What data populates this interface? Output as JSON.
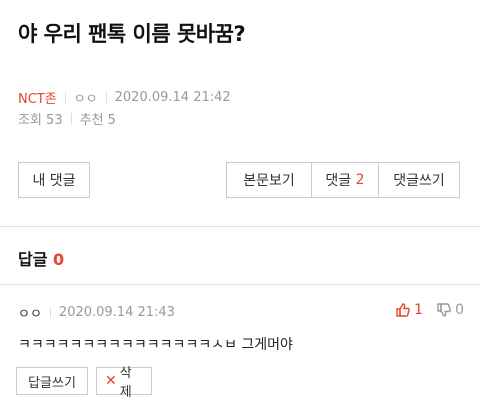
{
  "post": {
    "title": "야 우리 팬톡 이름 못바꿈?",
    "board": "NCT존",
    "author": "ㅇㅇ",
    "datetime": "2020.09.14 21:42",
    "views": "조회 53",
    "recommend": "추천 5"
  },
  "buttons": {
    "my_comments": "내 댓글",
    "view_body": "본문보기",
    "comments_label": "댓글",
    "comments_count": "2",
    "write_comment": "댓글쓰기"
  },
  "replies": {
    "label": "답글",
    "count": "0"
  },
  "comment": {
    "author": "ㅇㅇ",
    "datetime": "2020.09.14 21:43",
    "likes": "1",
    "dislikes": "0",
    "text": "ㅋㅋㅋㅋㅋㅋㅋㅋㅋㅋㅋㅋㅋㅋㅋㅅㅂ 그게머야",
    "reply_button": "답글쓰기",
    "delete_button": "삭제"
  },
  "colors": {
    "accent": "#e8442e",
    "muted": "#999999",
    "border": "#cccccc"
  },
  "icons": {
    "like": "thumbs-up-icon",
    "dislike": "thumbs-down-icon",
    "delete": "x-icon"
  }
}
